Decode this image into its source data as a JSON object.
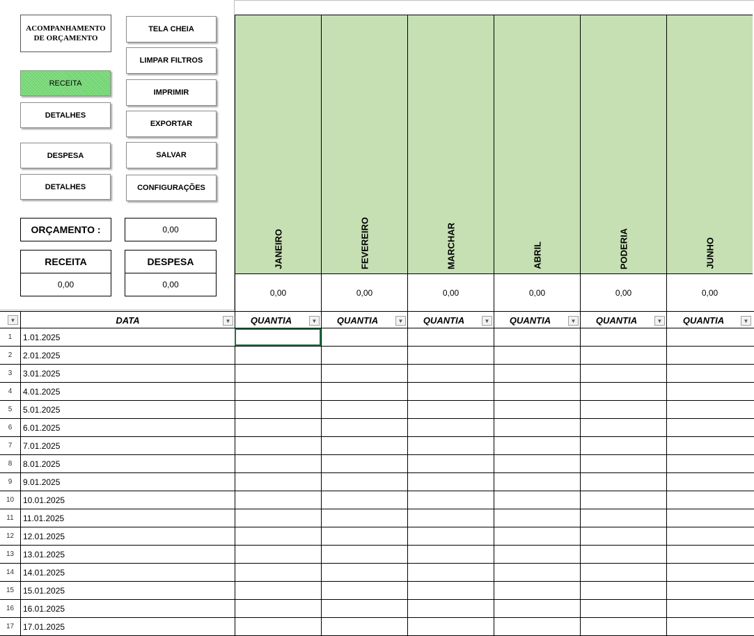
{
  "panel": {
    "title_button": "ACOMPANHAMENTO DE ORÇAMENTO",
    "left_buttons": {
      "receita": "RECEITA",
      "receita_detalhes": "DETALHES",
      "despesa": "DESPESA",
      "despesa_detalhes": "DETALHES"
    },
    "right_buttons": {
      "tela_cheia": "TELA CHEIA",
      "limpar_filtros": "LIMPAR FILTROS",
      "imprimir": "IMPRIMIR",
      "exportar": "EXPORTAR",
      "salvar": "SALVAR",
      "configuracoes": "CONFIGURAÇÕES"
    },
    "orcamento_label": "ORÇAMENTO :",
    "orcamento_value": "0,00",
    "receita_label": "RECEITA",
    "receita_value": "0,00",
    "despesa_label": "DESPESA",
    "despesa_value": "0,00",
    "active_color": "#6fd46f"
  },
  "months": [
    {
      "name": "JANEIRO",
      "total": "0,00"
    },
    {
      "name": "FEVEREIRO",
      "total": "0,00"
    },
    {
      "name": "MARCHAR",
      "total": "0,00"
    },
    {
      "name": "ABRIL",
      "total": "0,00"
    },
    {
      "name": "PODERIA",
      "total": "0,00"
    },
    {
      "name": "JUNHO",
      "total": "0,00"
    }
  ],
  "month_header_color": "#c6e0b4",
  "table": {
    "date_header": "DATA",
    "amount_header": "QUANTIA",
    "rows": [
      {
        "n": "1",
        "date": "1.01.2025"
      },
      {
        "n": "2",
        "date": "2.01.2025"
      },
      {
        "n": "3",
        "date": "3.01.2025"
      },
      {
        "n": "4",
        "date": "4.01.2025"
      },
      {
        "n": "5",
        "date": "5.01.2025"
      },
      {
        "n": "6",
        "date": "6.01.2025"
      },
      {
        "n": "7",
        "date": "7.01.2025"
      },
      {
        "n": "8",
        "date": "8.01.2025"
      },
      {
        "n": "9",
        "date": "9.01.2025"
      },
      {
        "n": "10",
        "date": "10.01.2025"
      },
      {
        "n": "11",
        "date": "11.01.2025"
      },
      {
        "n": "12",
        "date": "12.01.2025"
      },
      {
        "n": "13",
        "date": "13.01.2025"
      },
      {
        "n": "14",
        "date": "14.01.2025"
      },
      {
        "n": "15",
        "date": "15.01.2025"
      },
      {
        "n": "16",
        "date": "16.01.2025"
      },
      {
        "n": "17",
        "date": "17.01.2025"
      }
    ]
  }
}
